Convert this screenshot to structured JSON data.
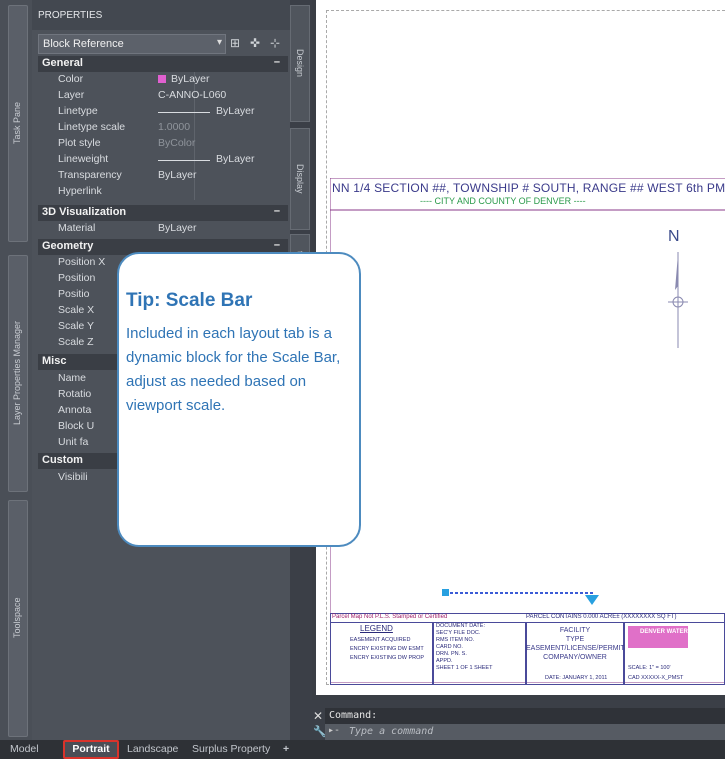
{
  "left_strip": {
    "task_pane": "Task Pane",
    "layer_manager": "Layer Properties Manager",
    "toolspace": "Toolspace"
  },
  "palette": {
    "title": "PROPERTIES",
    "selector": "Block Reference",
    "sections": {
      "general": "General",
      "viz": "3D Visualization",
      "geometry": "Geometry",
      "misc": "Misc",
      "custom": "Custom"
    },
    "general_rows": [
      {
        "k": "Color",
        "v": "ByLayer"
      },
      {
        "k": "Layer",
        "v": "C-ANNO-L060"
      },
      {
        "k": "Linetype",
        "v": "ByLayer"
      },
      {
        "k": "Linetype scale",
        "v": "1.0000"
      },
      {
        "k": "Plot style",
        "v": "ByColor"
      },
      {
        "k": "Lineweight",
        "v": "ByLayer"
      },
      {
        "k": "Transparency",
        "v": "ByLayer"
      },
      {
        "k": "Hyperlink",
        "v": ""
      }
    ],
    "viz_rows": [
      {
        "k": "Material",
        "v": "ByLayer"
      }
    ],
    "geometry_rows": [
      "Position X",
      "Position",
      "Positio",
      "Scale X",
      "Scale Y",
      "Scale Z"
    ],
    "misc_rows": [
      "Name",
      "Rotatio",
      "Annota",
      "Block U",
      "Unit fa"
    ],
    "custom_rows": [
      "Visibili"
    ],
    "side_tabs": {
      "design": "Design",
      "display": "Display",
      "extra": "ta"
    }
  },
  "drawing": {
    "section_title": "NN 1/4 SECTION ##, TOWNSHIP # SOUTH, RANGE ## WEST 6th PM",
    "city": "---- CITY AND COUNTY OF DENVER ----",
    "north": "N",
    "titleblock": {
      "note": "Parcel Map Not P.L.S. Stamped or Certified",
      "parcel": "PARCEL CONTAINS 0.000 ACRE± (XXXXXXXX SQ FT)",
      "legend": "LEGEND",
      "legend_items": [
        "EASEMENT ACQUIRED",
        "ENCRY EXISTING DW ESMT",
        "ENCRY EXISTING DW PROP"
      ],
      "doc": [
        "DOCUMENT DATE:",
        "SEC'Y FILE   DOC.",
        "RMS ITEM NO.",
        "CARD NO.",
        "DRN.    PN.    S.",
        "APPD.",
        "SHEET 1 OF 1 SHEET"
      ],
      "facility": [
        "FACILITY",
        "TYPE",
        "EASEMENT/LICENSE/PERMIT",
        "COMPANY/OWNER"
      ],
      "date": "DATE: JANUARY 1, 2011",
      "brand": "DENVER WATER",
      "scale": "SCALE: 1\" = 100'",
      "cad": "CAD XXXXX-X_PMST"
    }
  },
  "tip": {
    "title": "Tip: Scale Bar",
    "body": "Included in each layout tab is a dynamic block for the Scale Bar, adjust as needed based on viewport scale."
  },
  "command": {
    "label": "Command:",
    "placeholder": "Type a command"
  },
  "tabs": [
    "Model",
    "Portrait",
    "Landscape",
    "Surplus Property",
    "+"
  ],
  "colors": {
    "tip_border": "#4d8bbf",
    "tip_text": "#2f74b5",
    "active_tab_border": "#d9332b"
  }
}
